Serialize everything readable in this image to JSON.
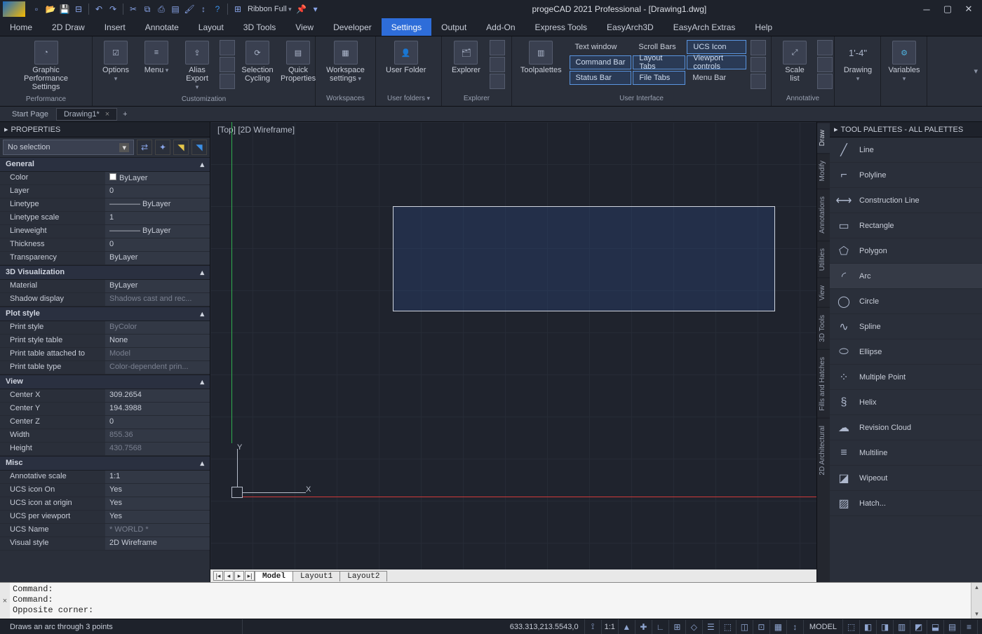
{
  "title": "progeCAD 2021 Professional - [Drawing1.dwg]",
  "ribbon_mode": "Ribbon Full",
  "menubar": [
    "Home",
    "2D Draw",
    "Insert",
    "Annotate",
    "Layout",
    "3D Tools",
    "View",
    "Developer",
    "Settings",
    "Output",
    "Add-On",
    "Express Tools",
    "EasyArch3D",
    "EasyArch Extras",
    "Help"
  ],
  "menubar_active": "Settings",
  "ribbon": {
    "groups": {
      "performance": {
        "label": "Performance",
        "item": "Graphic Performance Settings"
      },
      "customization": {
        "label": "Customization",
        "items": [
          "Options",
          "Menu",
          "Alias Export",
          "Selection Cycling",
          "Quick Properties"
        ]
      },
      "workspaces": {
        "label": "Workspaces",
        "item": "Workspace settings"
      },
      "user_folders": {
        "label": "User folders",
        "item": "User Folder"
      },
      "explorer": {
        "label": "Explorer",
        "item": "Explorer"
      },
      "toolpalettes": "Toolpalettes",
      "ui": {
        "label": "User Interface",
        "buttons": [
          "Text window",
          "Scroll Bars",
          "UCS Icon",
          "Command Bar",
          "Layout Tabs",
          "Viewport controls",
          "Status Bar",
          "File Tabs",
          "Menu Bar"
        ]
      },
      "annotative": {
        "label": "Annotative",
        "item": "Scale list"
      },
      "drawing": "Drawing",
      "variables": "Variables",
      "dim_label": "1'-4\""
    }
  },
  "doc_tabs": {
    "start": "Start Page",
    "active": "Drawing1*"
  },
  "properties": {
    "title": "PROPERTIES",
    "selection": "No selection",
    "sections": [
      {
        "name": "General",
        "rows": [
          {
            "k": "Color",
            "v": "ByLayer",
            "swatch": true
          },
          {
            "k": "Layer",
            "v": "0"
          },
          {
            "k": "Linetype",
            "v": "———— ByLayer"
          },
          {
            "k": "Linetype scale",
            "v": "1"
          },
          {
            "k": "Lineweight",
            "v": "———— ByLayer"
          },
          {
            "k": "Thickness",
            "v": "0"
          },
          {
            "k": "Transparency",
            "v": "ByLayer"
          }
        ]
      },
      {
        "name": "3D Visualization",
        "rows": [
          {
            "k": "Material",
            "v": "ByLayer"
          },
          {
            "k": "Shadow display",
            "v": "Shadows cast and rec...",
            "dim": true
          }
        ]
      },
      {
        "name": "Plot style",
        "rows": [
          {
            "k": "Print style",
            "v": "ByColor",
            "dim": true
          },
          {
            "k": "Print style table",
            "v": "None"
          },
          {
            "k": "Print table attached to",
            "v": "Model",
            "dim": true
          },
          {
            "k": "Print table type",
            "v": "Color-dependent prin...",
            "dim": true
          }
        ]
      },
      {
        "name": "View",
        "rows": [
          {
            "k": "Center X",
            "v": "309.2654"
          },
          {
            "k": "Center Y",
            "v": "194.3988"
          },
          {
            "k": "Center Z",
            "v": "0"
          },
          {
            "k": "Width",
            "v": "855.36",
            "dim": true
          },
          {
            "k": "Height",
            "v": "430.7568",
            "dim": true
          }
        ]
      },
      {
        "name": "Misc",
        "rows": [
          {
            "k": "Annotative scale",
            "v": "1:1"
          },
          {
            "k": "UCS icon On",
            "v": "Yes"
          },
          {
            "k": "UCS icon at origin",
            "v": "Yes"
          },
          {
            "k": "UCS per viewport",
            "v": "Yes"
          },
          {
            "k": "UCS Name",
            "v": "* WORLD *",
            "dim": true
          },
          {
            "k": "Visual style",
            "v": "2D Wireframe"
          }
        ]
      }
    ]
  },
  "view_label": "[Top] [2D Wireframe]",
  "layout_tabs": [
    "Model",
    "Layout1",
    "Layout2"
  ],
  "commandline": "Command:\nCommand:\nOpposite corner:",
  "toolpalette": {
    "title": "TOOL PALETTES - ALL PALETTES",
    "tabs": [
      "Draw",
      "Modify",
      "Annotations",
      "Utilities",
      "View",
      "3D Tools",
      "Fills and Hatches",
      "2D Architectural"
    ],
    "active_tab": "Draw",
    "items": [
      "Line",
      "Polyline",
      "Construction Line",
      "Rectangle",
      "Polygon",
      "Arc",
      "Circle",
      "Spline",
      "Ellipse",
      "Multiple Point",
      "Helix",
      "Revision Cloud",
      "Multiline",
      "Wipeout",
      "Hatch..."
    ],
    "selected": "Arc"
  },
  "status": {
    "hint": "Draws an arc through 3 points",
    "coords": "633.313,213.5543,0",
    "scale": "1:1",
    "model": "MODEL"
  }
}
